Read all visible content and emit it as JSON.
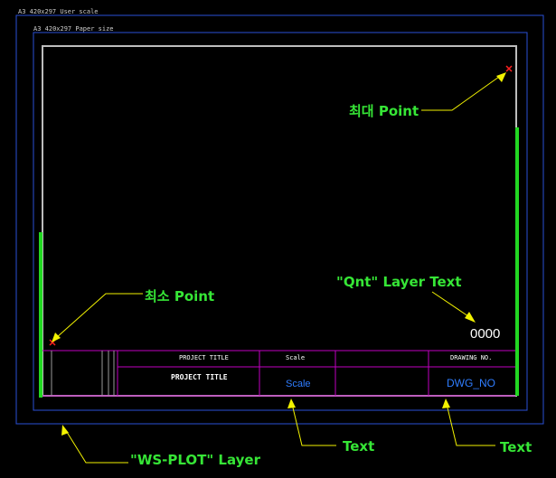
{
  "labels": {
    "user_scale": "A3 420x297 User scale",
    "paper_size": "A3 420x297 Paper size"
  },
  "callouts": {
    "max_point": "최대 Point",
    "min_point": "최소 Point",
    "qnt_layer": "\"Qnt\" Layer Text",
    "ws_plot_layer": "\"WS-PLOT\" Layer",
    "text_scale": "Text",
    "text_dwg": "Text"
  },
  "counter": "0000",
  "title_block": {
    "project_title_header": "PROJECT TITLE",
    "project_title_value": "PROJECT TITLE",
    "scale_header": "Scale",
    "scale_value": "Scale",
    "drawing_no_header": "DRAWING NO.",
    "drawing_no_value": "DWG_NO"
  },
  "colors": {
    "background": "#000000",
    "outer_frame": "#2a4fd6",
    "drawing_border": "#bdbdbd",
    "title_block_lines": "#c000c0",
    "green_accent": "#22d822",
    "callout_arrow": "#f2f200",
    "point_marker": "#ff2020",
    "value_text": "#2f7dff"
  }
}
